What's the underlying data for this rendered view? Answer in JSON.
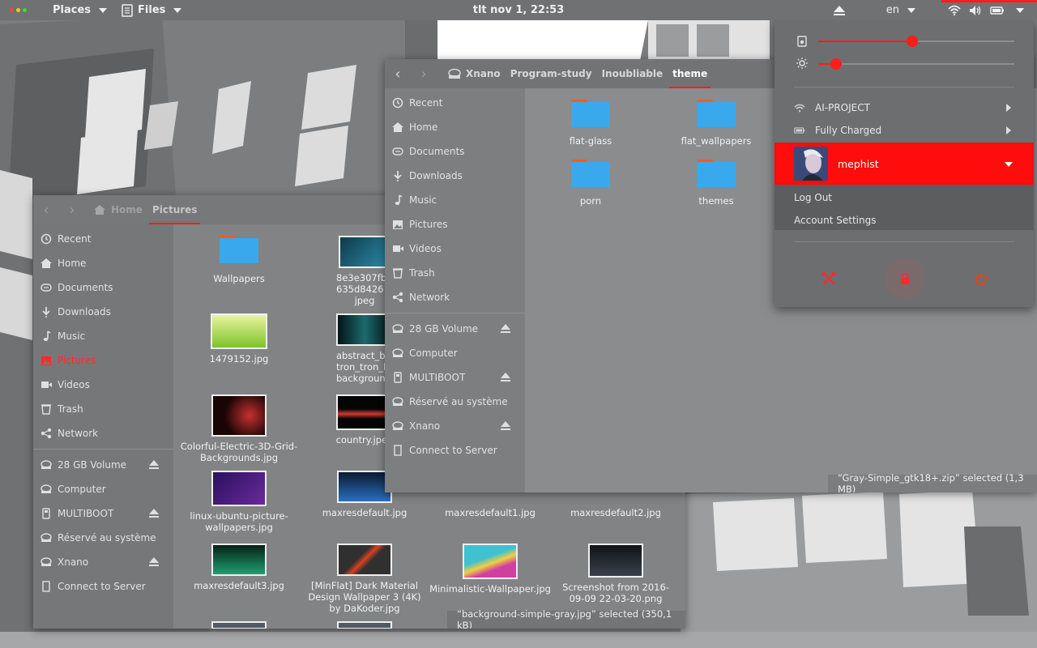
{
  "topbar": {
    "places_label": "Places",
    "files_label": "Files",
    "clock": "tlt nov  1, 22:53",
    "keyboard_layout": "en",
    "icons": [
      "activities-dots-icon",
      "files-app-icon",
      "upload-icon",
      "wifi-icon",
      "volume-icon",
      "battery-icon",
      "power-caret-icon"
    ],
    "dot_colors": [
      "#ff4141",
      "#ffc31a",
      "#43d843"
    ]
  },
  "back_window": {
    "breadcrumbs": [
      "Home",
      "Pictures"
    ],
    "sidebar": {
      "places": [
        {
          "label": "Recent",
          "icon": "clock-icon"
        },
        {
          "label": "Home",
          "icon": "home-icon"
        },
        {
          "label": "Documents",
          "icon": "documents-icon"
        },
        {
          "label": "Downloads",
          "icon": "download-icon"
        },
        {
          "label": "Music",
          "icon": "music-icon"
        },
        {
          "label": "Pictures",
          "icon": "pictures-icon"
        },
        {
          "label": "Videos",
          "icon": "video-icon"
        },
        {
          "label": "Trash",
          "icon": "trash-icon"
        },
        {
          "label": "Network",
          "icon": "network-icon"
        }
      ],
      "devices": [
        {
          "label": "28 GB Volume",
          "icon": "drive-icon"
        },
        {
          "label": "Computer",
          "icon": "drive-icon"
        },
        {
          "label": "MULTIBOOT",
          "icon": "usb-icon"
        },
        {
          "label": "Réservé au système",
          "icon": "drive-icon"
        },
        {
          "label": "Xnano",
          "icon": "drive-icon"
        },
        {
          "label": "Connect to Server",
          "icon": "server-icon"
        }
      ]
    },
    "files": [
      {
        "name": "Wallpapers"
      },
      {
        "name": "8e3e307fbb0b78 635d842612e1 jpeg"
      },
      {
        "name": "1479152.jpg"
      },
      {
        "name": "abstract_blue_ tron_tron_legacy backgrounds_al"
      },
      {
        "name": "Colorful-Electric-3D-Grid-Backgrounds.jpg"
      },
      {
        "name": "country.jpeg"
      },
      {
        "name": "linux-ubuntu-picture-wallpapers.jpg"
      },
      {
        "name": "maxresdefault.jpg"
      },
      {
        "name": "maxresdefault1.jpg"
      },
      {
        "name": "maxresdefault2.jpg"
      },
      {
        "name": "maxresdefault3.jpg"
      },
      {
        "name": "[MinFlat] Dark Material Design Wallpaper 3 (4K) by DaKoder.jpg"
      },
      {
        "name": "Minimalistic-Wallpaper.jpg"
      },
      {
        "name": "Screenshot from 2016-09-09 22-03-20.png"
      }
    ],
    "status": "“background-simple-gray.jpg” selected  (350,1 kB)"
  },
  "front_window": {
    "breadcrumbs": [
      "Xnano",
      "Program-study",
      "Inoubliable",
      "theme"
    ],
    "sidebar": {
      "places": [
        {
          "label": "Recent",
          "icon": "clock-icon"
        },
        {
          "label": "Home",
          "icon": "home-icon"
        },
        {
          "label": "Documents",
          "icon": "documents-icon"
        },
        {
          "label": "Downloads",
          "icon": "download-icon"
        },
        {
          "label": "Music",
          "icon": "music-icon"
        },
        {
          "label": "Pictures",
          "icon": "pictures-icon"
        },
        {
          "label": "Videos",
          "icon": "video-icon"
        },
        {
          "label": "Trash",
          "icon": "trash-icon"
        },
        {
          "label": "Network",
          "icon": "network-icon"
        }
      ],
      "devices": [
        {
          "label": "28 GB Volume",
          "icon": "drive-icon"
        },
        {
          "label": "Computer",
          "icon": "drive-icon"
        },
        {
          "label": "MULTIBOOT",
          "icon": "usb-icon"
        },
        {
          "label": "Réservé au système",
          "icon": "drive-icon"
        },
        {
          "label": "Xnano",
          "icon": "drive-icon"
        },
        {
          "label": "Connect to Server",
          "icon": "server-icon"
        }
      ]
    },
    "files": [
      {
        "name": "flat-glass"
      },
      {
        "name": "flat_wallpapers"
      },
      {
        "name": "porn"
      },
      {
        "name": "themes"
      }
    ],
    "status": "“Gray-Simple_gtk18+.zip” selected  (1,3 MB)"
  },
  "system_menu": {
    "volume_level": 0.48,
    "brightness_level": 0.09,
    "wifi_label": "AI-PROJECT",
    "battery_label": "Fully Charged",
    "user_name": "mephist",
    "logout_label": "Log Out",
    "account_settings_label": "Account Settings",
    "accent_color": "#ff1d1d",
    "buttons": [
      "settings-icon",
      "lock-icon",
      "power-icon"
    ]
  }
}
